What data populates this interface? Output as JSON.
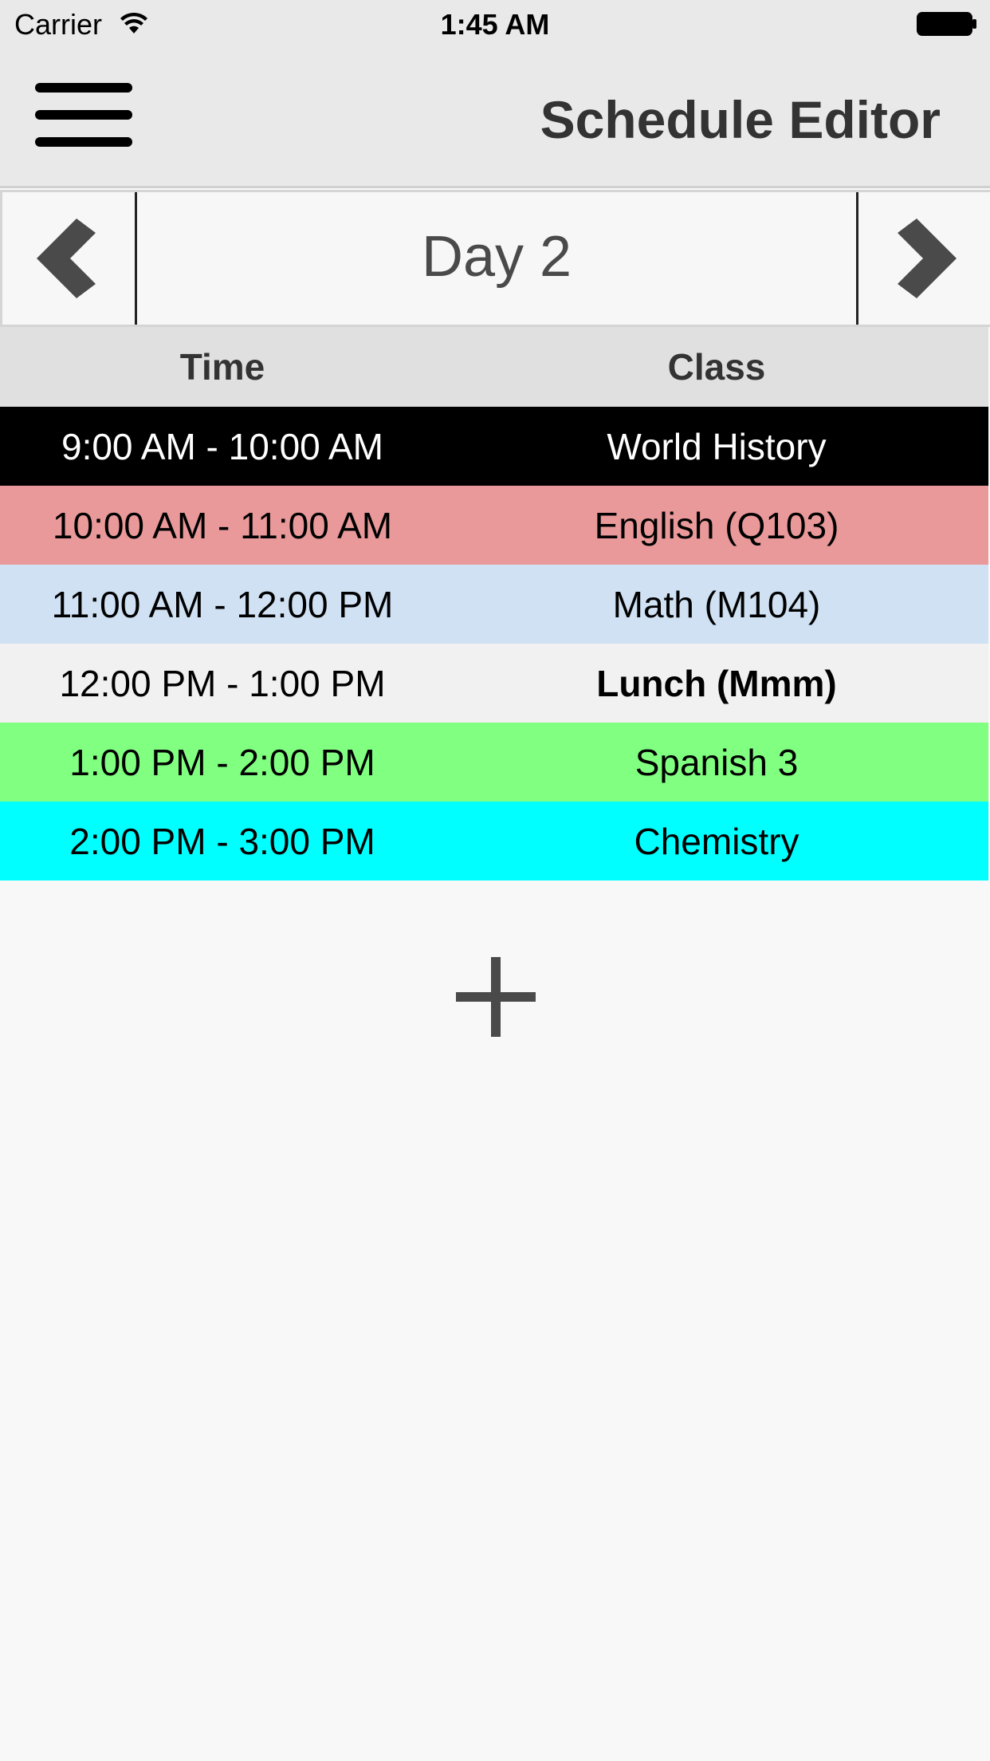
{
  "status_bar": {
    "carrier": "Carrier",
    "time": "1:45 AM"
  },
  "nav_bar": {
    "title": "Schedule Editor",
    "menu_icon": "hamburger-menu-icon"
  },
  "day_nav": {
    "label": "Day 2",
    "prev_icon": "chevron-left-icon",
    "next_icon": "chevron-right-icon"
  },
  "table": {
    "headers": {
      "time": "Time",
      "class": "Class"
    },
    "rows": [
      {
        "time": "9:00 AM - 10:00 AM",
        "class": "World History",
        "bg": "#000000",
        "fg": "#ffffff",
        "bold": false
      },
      {
        "time": "10:00 AM - 11:00 AM",
        "class": "English (Q103)",
        "bg": "#e99999",
        "fg": "#000000",
        "bold": false
      },
      {
        "time": "11:00 AM - 12:00 PM",
        "class": "Math (M104)",
        "bg": "#cfe1f3",
        "fg": "#000000",
        "bold": false
      },
      {
        "time": "12:00 PM - 1:00 PM",
        "class": "Lunch (Mmm)",
        "bg": "#f1f1f1",
        "fg": "#000000",
        "bold": true
      },
      {
        "time": "1:00 PM - 2:00 PM",
        "class": "Spanish 3",
        "bg": "#80ff80",
        "fg": "#000000",
        "bold": false
      },
      {
        "time": "2:00 PM - 3:00 PM",
        "class": "Chemistry",
        "bg": "#00ffff",
        "fg": "#000000",
        "bold": false
      }
    ]
  },
  "add_button": {
    "icon": "plus-icon"
  },
  "colors": {
    "bar_bg": "#e9e9e9",
    "icon_gray": "#4a4a4a",
    "page_bg": "#f8f8f8"
  }
}
